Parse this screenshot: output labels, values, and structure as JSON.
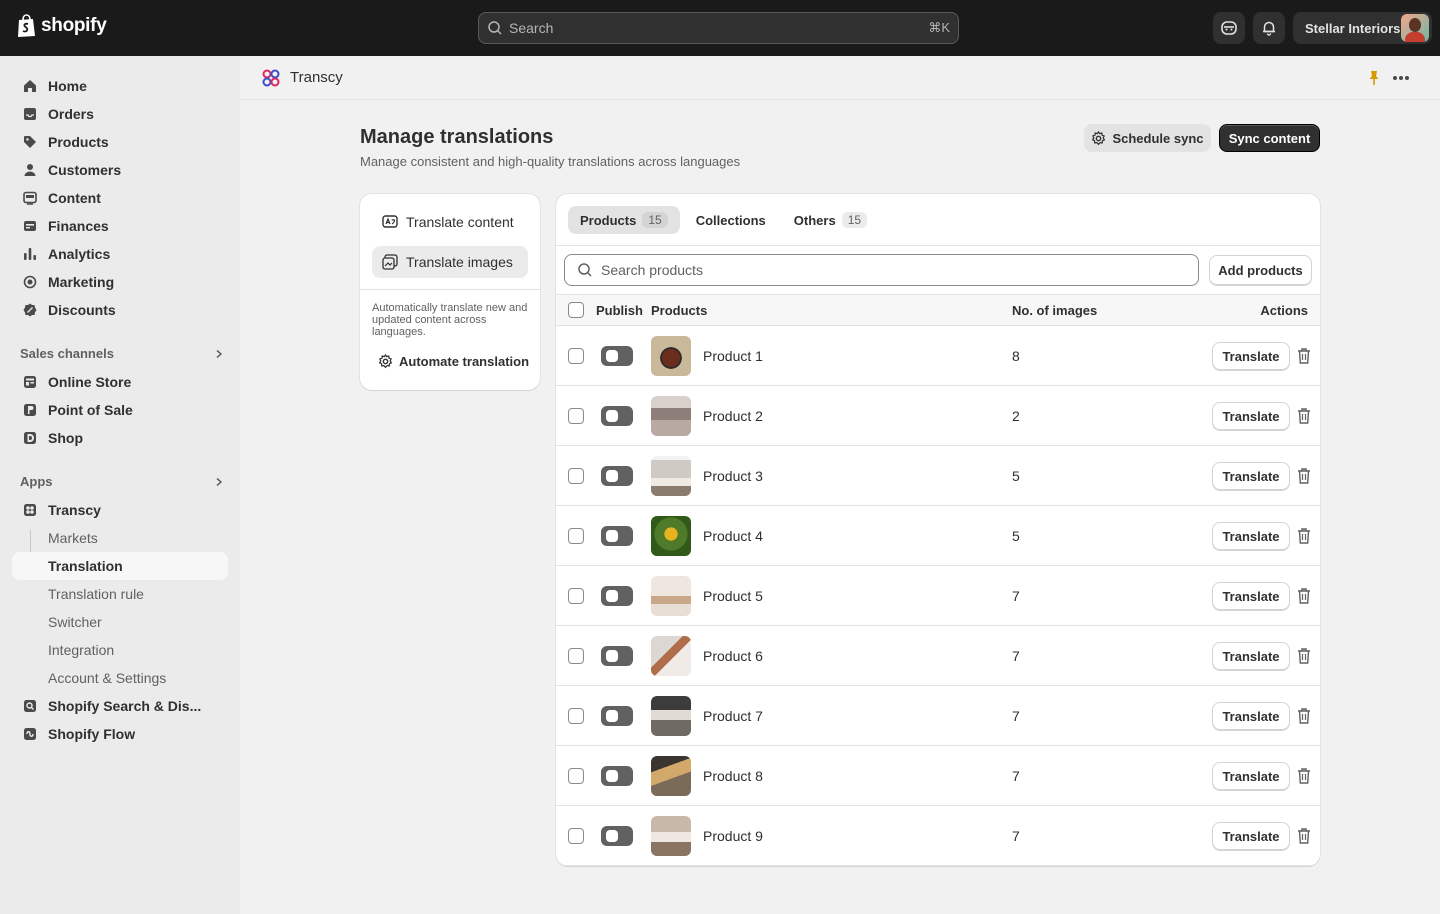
{
  "topbar": {
    "logo_text": "shopify",
    "search_placeholder": "Search",
    "search_shortcut": "⌘K",
    "store_name": "Stellar Interiors"
  },
  "sidebar": {
    "items": [
      {
        "label": "Home",
        "icon": "home-icon"
      },
      {
        "label": "Orders",
        "icon": "orders-icon"
      },
      {
        "label": "Products",
        "icon": "tag-icon"
      },
      {
        "label": "Customers",
        "icon": "person-icon"
      },
      {
        "label": "Content",
        "icon": "content-icon"
      },
      {
        "label": "Finances",
        "icon": "bank-icon"
      },
      {
        "label": "Analytics",
        "icon": "bar-chart-icon"
      },
      {
        "label": "Marketing",
        "icon": "target-icon"
      },
      {
        "label": "Discounts",
        "icon": "discount-icon"
      }
    ],
    "sales_channels_label": "Sales channels",
    "channels": [
      {
        "label": "Online Store",
        "icon": "store-icon"
      },
      {
        "label": "Point of Sale",
        "icon": "pos-icon"
      },
      {
        "label": "Shop",
        "icon": "shop-icon"
      }
    ],
    "apps_label": "Apps",
    "app_main": "Transcy",
    "app_subs": [
      "Markets",
      "Translation",
      "Translation rule",
      "Switcher",
      "Integration",
      "Account & Settings"
    ],
    "other_apps": [
      "Shopify Search & Dis...",
      "Shopify Flow"
    ]
  },
  "appbar": {
    "app_name": "Transcy"
  },
  "page": {
    "title": "Manage translations",
    "subtitle": "Manage consistent and high-quality translations across languages",
    "schedule_sync": "Schedule sync",
    "sync_content": "Sync content"
  },
  "left_card": {
    "translate_content": "Translate content",
    "translate_images": "Translate images",
    "description": "Automatically translate new and updated content across languages.",
    "automate": "Automate translation"
  },
  "tabs": [
    {
      "label": "Products",
      "count": "15"
    },
    {
      "label": "Collections",
      "count": ""
    },
    {
      "label": "Others",
      "count": "15"
    }
  ],
  "product_search_placeholder": "Search products",
  "add_products": "Add products",
  "table": {
    "headers": {
      "publish": "Publish",
      "products": "Products",
      "images": "No. of images",
      "actions": "Actions"
    },
    "translate_label": "Translate",
    "rows": [
      {
        "name": "Product 1",
        "images": "8"
      },
      {
        "name": "Product 2",
        "images": "2"
      },
      {
        "name": "Product 3",
        "images": "5"
      },
      {
        "name": "Product 4",
        "images": "5"
      },
      {
        "name": "Product 5",
        "images": "7"
      },
      {
        "name": "Product 6",
        "images": "7"
      },
      {
        "name": "Product 7",
        "images": "7"
      },
      {
        "name": "Product 8",
        "images": "7"
      },
      {
        "name": "Product 9",
        "images": "7"
      }
    ]
  }
}
